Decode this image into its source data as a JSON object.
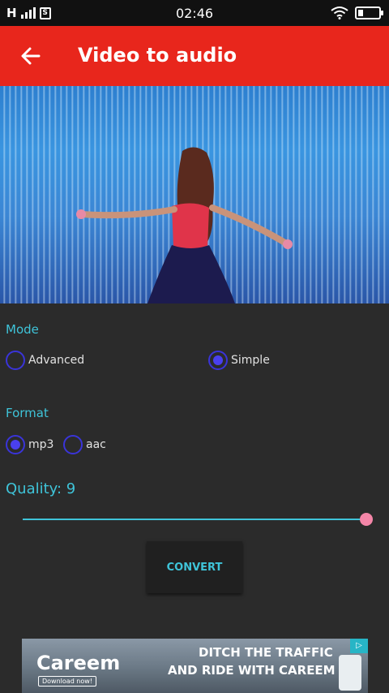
{
  "status_bar": {
    "network": "H",
    "sim": "S",
    "time": "02:46"
  },
  "app_bar": {
    "title": "Video to audio"
  },
  "mode": {
    "label": "Mode",
    "options": [
      {
        "label": "Advanced",
        "selected": false
      },
      {
        "label": "Simple",
        "selected": true
      }
    ]
  },
  "format": {
    "label": "Format",
    "options": [
      {
        "label": "mp3",
        "selected": true
      },
      {
        "label": "aac",
        "selected": false
      }
    ]
  },
  "quality": {
    "label": "Quality: 9",
    "value": 9
  },
  "convert_button": {
    "label": "CONVERT"
  },
  "ad": {
    "brand": "Careem",
    "download_label": "Download now!",
    "headline_1": "DITCH THE TRAFFIC",
    "headline_2": "AND RIDE WITH CAREEM"
  },
  "colors": {
    "app_bar": "#e8261c",
    "accent": "#3fc4d9",
    "radio": "#4a40ee",
    "slider_thumb": "#f486a8",
    "background": "#2b2b2b"
  }
}
